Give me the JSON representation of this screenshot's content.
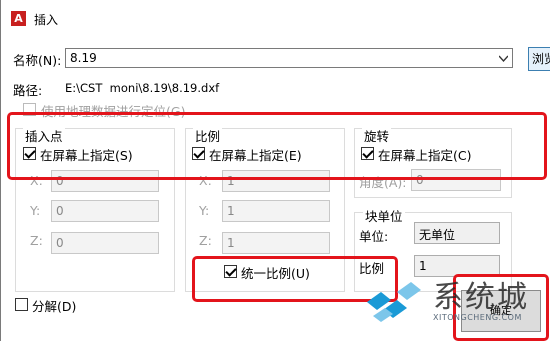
{
  "dialog": {
    "title": "插入",
    "name_label": "名称(N):",
    "name_value": "8.19",
    "browse_label": "浏览",
    "path_label": "路径:",
    "path_value": "E:\\CST  moni\\8.19\\8.19.dxf",
    "geo_label": "使用地理数据进行定位(G)",
    "insertion": {
      "title": "插入点",
      "specify_label": "在屏幕上指定(S)",
      "x_label": "X:",
      "x_value": "0",
      "y_label": "Y:",
      "y_value": "0",
      "z_label": "Z:",
      "z_value": "0"
    },
    "scale": {
      "title": "比例",
      "specify_label": "在屏幕上指定(E)",
      "x_label": "X:",
      "x_value": "1",
      "y_label": "Y:",
      "y_value": "1",
      "z_label": "Z:",
      "z_value": "1",
      "uniform_label": "统一比例(U)"
    },
    "rotation": {
      "title": "旋转",
      "specify_label": "在屏幕上指定(C)",
      "angle_label": "角度(A):",
      "angle_value": "0"
    },
    "block_unit": {
      "title": "块单位",
      "unit_label": "单位:",
      "unit_value": "无单位",
      "factor_label": "比例",
      "factor_value": "1"
    },
    "explode_label": "分解(D)",
    "ok_label": "确定"
  },
  "watermark": {
    "text": "系统城",
    "url": "XITONGCHENG.COM"
  },
  "colors": {
    "highlight": "#e3141b",
    "accent": "#1a9ad6"
  }
}
